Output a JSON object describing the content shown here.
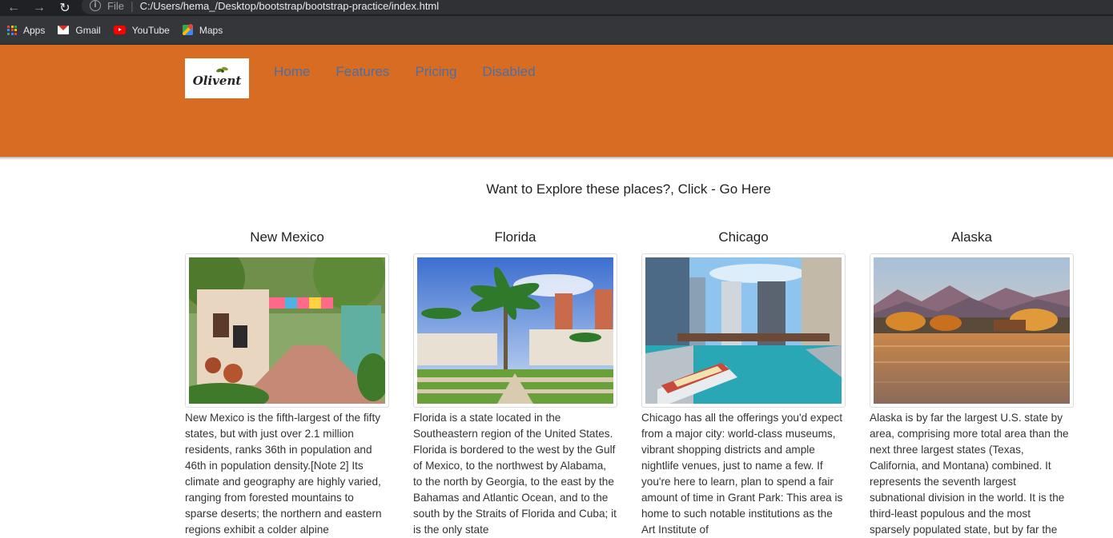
{
  "browser": {
    "file_label": "File",
    "url": "C:/Users/hema_/Desktop/bootstrap/bootstrap-practice/index.html",
    "bookmarks": [
      {
        "label": "Apps",
        "icon": "apps-grid-icon"
      },
      {
        "label": "Gmail",
        "icon": "gmail-icon"
      },
      {
        "label": "YouTube",
        "icon": "youtube-icon"
      },
      {
        "label": "Maps",
        "icon": "maps-icon"
      }
    ]
  },
  "header": {
    "logo_text": "Olivent",
    "background_color": "#d76c22",
    "nav": [
      {
        "label": "Home"
      },
      {
        "label": "Features"
      },
      {
        "label": "Pricing"
      },
      {
        "label": "Disabled"
      }
    ]
  },
  "intro": "Want to Explore these places?, Click - Go Here",
  "cards": [
    {
      "title": "New Mexico",
      "description": "New Mexico is the fifth-largest of the fifty states, but with just over 2.1 million residents, ranks 36th in population and 46th in population density.[Note 2] Its climate and geography are highly varied, ranging from forested mountains to sparse deserts; the northern and eastern regions exhibit a colder alpine"
    },
    {
      "title": "Florida",
      "description": "Florida is a state located in the Southeastern region of the United States. Florida is bordered to the west by the Gulf of Mexico, to the northwest by Alabama, to the north by Georgia, to the east by the Bahamas and Atlantic Ocean, and to the south by the Straits of Florida and Cuba; it is the only state"
    },
    {
      "title": "Chicago",
      "description": "Chicago has all the offerings you'd expect from a major city: world-class museums, vibrant shopping districts and ample nightlife venues, just to name a few. If you're here to learn, plan to spend a fair amount of time in Grant Park: This area is home to such notable institutions as the Art Institute of"
    },
    {
      "title": "Alaska",
      "description": "Alaska is by far the largest U.S. state by area, comprising more total area than the next three largest states (Texas, California, and Montana) combined. It represents the seventh largest subnational division in the world. It is the third-least populous and the most sparsely populated state, but by far the"
    }
  ]
}
